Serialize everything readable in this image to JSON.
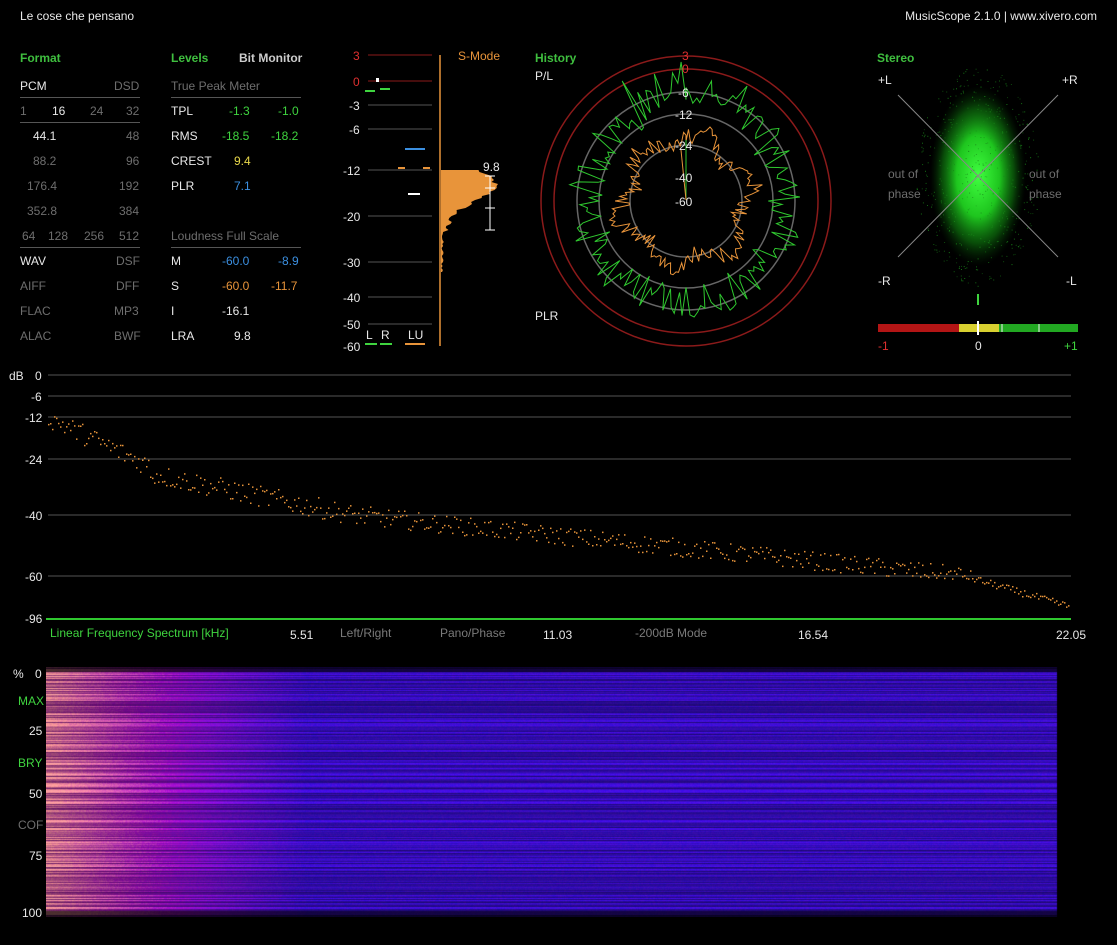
{
  "window": {
    "track_title": "Le cose che pensano",
    "app_title": "MusicScope 2.1.0 | www.xivero.com"
  },
  "format": {
    "title": "Format",
    "pcm": "PCM",
    "dsd": "DSD",
    "bits": [
      "1",
      "16",
      "24",
      "32"
    ],
    "rates": [
      [
        "44.1",
        "48"
      ],
      [
        "88.2",
        "96"
      ],
      [
        "176.4",
        "192"
      ],
      [
        "352.8",
        "384"
      ]
    ],
    "dsd_rates": [
      "64",
      "128",
      "256",
      "512"
    ],
    "containers": [
      [
        "WAV",
        "DSF"
      ],
      [
        "AIFF",
        "DFF"
      ],
      [
        "FLAC",
        "MP3"
      ],
      [
        "ALAC",
        "BWF"
      ]
    ]
  },
  "levels": {
    "title": "Levels",
    "bit_monitor": "Bit Monitor",
    "true_peak_header": "True Peak Meter",
    "rows": [
      {
        "label": "TPL",
        "l": "-1.3",
        "r": "-1.0"
      },
      {
        "label": "RMS",
        "l": "-18.5",
        "r": "-18.2"
      },
      {
        "label": "CREST",
        "l": "9.4",
        "r": ""
      },
      {
        "label": "PLR",
        "l": "7.1",
        "r": ""
      }
    ],
    "loudness_header": "Loudness Full Scale",
    "loud_rows": [
      {
        "label": "M",
        "a": "-60.0",
        "b": "-8.9"
      },
      {
        "label": "S",
        "a": "-60.0",
        "b": "-11.7"
      },
      {
        "label": "I",
        "a": "-16.1",
        "b": ""
      },
      {
        "label": "LRA",
        "a": "9.8",
        "b": ""
      }
    ]
  },
  "meter": {
    "mode": "S-Mode",
    "scale": [
      "3",
      "0",
      "-3",
      "-6",
      "-12",
      "-20",
      "-30",
      "-40",
      "-50",
      "-60"
    ],
    "lra_value": "9.8",
    "channels": [
      "L",
      "R",
      "LU"
    ]
  },
  "history": {
    "title": "History",
    "pl_label": "P/L",
    "plr_label": "PLR",
    "rings": [
      "3",
      "0",
      "-6",
      "-12",
      "-24",
      "-40",
      "-60"
    ]
  },
  "stereo": {
    "title": "Stereo",
    "corners": [
      "+L",
      "+R",
      "-R",
      "-L"
    ],
    "out_of_phase": "out of phase",
    "corr_scale": [
      "-1",
      "0",
      "+1"
    ],
    "correlation": 0.0
  },
  "spectrum": {
    "db_label": "dB",
    "y_ticks": [
      "0",
      "-6",
      "-12",
      "-24",
      "-40",
      "-60",
      "-96"
    ],
    "x_ticks": [
      "5.51",
      "11.03",
      "16.54",
      "22.05"
    ],
    "title": "Linear Frequency Spectrum [kHz]",
    "modes": [
      "Left/Right",
      "Pano/Phase",
      "-200dB Mode"
    ]
  },
  "sonogram": {
    "y_labels": [
      "%",
      "0",
      "25",
      "50",
      "75",
      "100"
    ],
    "markers": [
      "MAX",
      "BRY",
      "COF"
    ]
  },
  "colors": {
    "green": "#3fd43f",
    "orange": "#e8943a",
    "blue": "#3b8fe0",
    "red": "#c82020"
  }
}
